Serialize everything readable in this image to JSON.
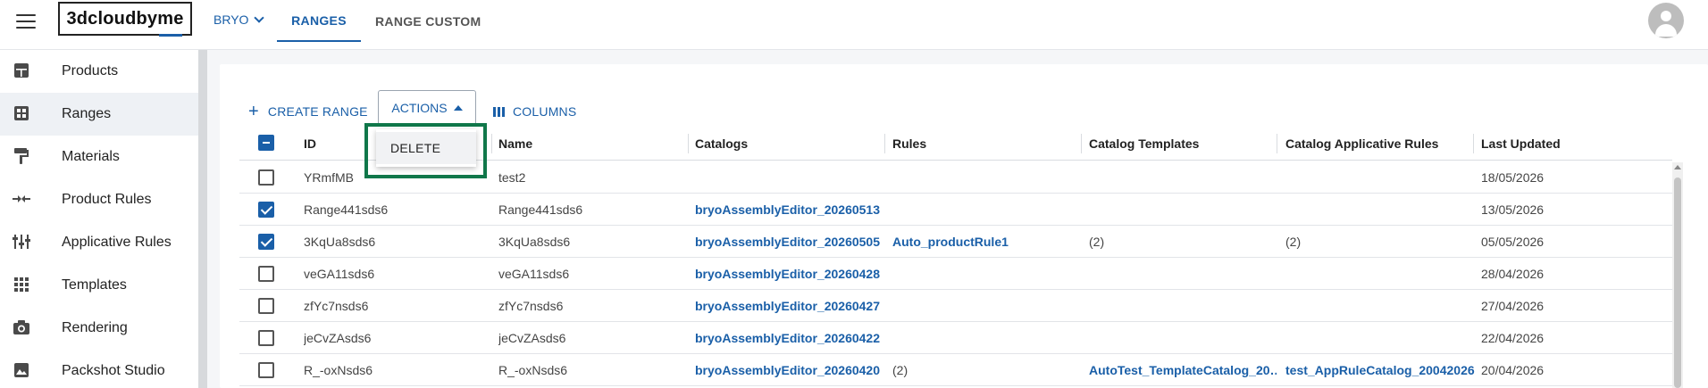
{
  "header": {
    "logo_text": "3dcloudbyme",
    "tenant": "BRYO",
    "tabs": [
      {
        "label": "RANGES",
        "active": true
      },
      {
        "label": "RANGE CUSTOM",
        "active": false
      }
    ]
  },
  "sidebar": {
    "items": [
      {
        "label": "Products",
        "icon": "products-icon"
      },
      {
        "label": "Ranges",
        "icon": "ranges-icon",
        "active": true
      },
      {
        "label": "Materials",
        "icon": "materials-icon"
      },
      {
        "label": "Product Rules",
        "icon": "product-rules-icon"
      },
      {
        "label": "Applicative Rules",
        "icon": "applicative-rules-icon"
      },
      {
        "label": "Templates",
        "icon": "templates-icon"
      },
      {
        "label": "Rendering",
        "icon": "camera-icon"
      },
      {
        "label": "Packshot Studio",
        "icon": "image-icon"
      }
    ]
  },
  "toolbar": {
    "create_label": "CREATE RANGE",
    "actions_label": "ACTIONS",
    "columns_label": "COLUMNS"
  },
  "actions_menu": {
    "items": [
      "DELETE"
    ]
  },
  "table": {
    "columns": [
      "ID",
      "Name",
      "Catalogs",
      "Rules",
      "Catalog Templates",
      "Catalog Applicative Rules",
      "Last Updated"
    ],
    "header_checkbox": "indeterminate",
    "rows": [
      {
        "checked": false,
        "id": "YRmfMB",
        "name": "test2",
        "catalogs": "",
        "rules": "",
        "catalog_templates": "",
        "catalog_applicative_rules": "",
        "last_updated": "18/05/2026"
      },
      {
        "checked": true,
        "id": "Range441sds6",
        "name": "Range441sds6",
        "catalogs": "bryoAssemblyEditor_20260513",
        "rules": "",
        "catalog_templates": "",
        "catalog_applicative_rules": "",
        "last_updated": "13/05/2026"
      },
      {
        "checked": true,
        "id": "3KqUa8sds6",
        "name": "3KqUa8sds6",
        "catalogs": "bryoAssemblyEditor_20260505",
        "rules": "Auto_productRule1",
        "catalog_templates": "(2)",
        "catalog_applicative_rules": "(2)",
        "last_updated": "05/05/2026"
      },
      {
        "checked": false,
        "id": "veGA11sds6",
        "name": "veGA11sds6",
        "catalogs": "bryoAssemblyEditor_20260428",
        "rules": "",
        "catalog_templates": "",
        "catalog_applicative_rules": "",
        "last_updated": "28/04/2026"
      },
      {
        "checked": false,
        "id": "zfYc7nsds6",
        "name": "zfYc7nsds6",
        "catalogs": "bryoAssemblyEditor_20260427",
        "rules": "",
        "catalog_templates": "",
        "catalog_applicative_rules": "",
        "last_updated": "27/04/2026"
      },
      {
        "checked": false,
        "id": "jeCvZAsds6",
        "name": "jeCvZAsds6",
        "catalogs": "bryoAssemblyEditor_20260422",
        "rules": "",
        "catalog_templates": "",
        "catalog_applicative_rules": "",
        "last_updated": "22/04/2026"
      },
      {
        "checked": false,
        "id": "R_-oxNsds6",
        "name": "R_-oxNsds6",
        "catalogs": "bryoAssemblyEditor_20260420",
        "rules": "(2)",
        "catalog_templates": "AutoTest_TemplateCatalog_20…",
        "catalog_applicative_rules": "test_AppRuleCatalog_20042026",
        "last_updated": "20/04/2026"
      }
    ]
  },
  "colors": {
    "accent": "#1a5fa8",
    "highlight": "#10774a"
  }
}
